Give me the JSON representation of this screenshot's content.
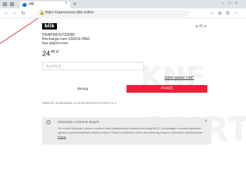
{
  "browser": {
    "tab_title": "blik",
    "url": "https://openscene.blik.online"
  },
  "header": {
    "logo": "blik",
    "lang": "PL"
  },
  "merchant": {
    "line1": "PDAFNK/G725086",
    "line2": "Recharge.com 1566117860",
    "line3": "live.adyen.com"
  },
  "payment": {
    "amount_main": "24",
    "amount_decimal": ",49 zł",
    "code_placeholder": "Kod BLIK",
    "where_link": "Gdzie wpisać kod?",
    "cancel_label": "Anuluj",
    "pay_label": "PŁACĘ",
    "provider_note": "Płatność obsługiwana za pośrednictwem PayPro S.A."
  },
  "alert": {
    "title": "Informacje o ochronie danych",
    "body": "Ten serwis korzysta z plików cookie w celu prawidłowego świadczenia usługi BLIK. Korzystając z serwisu wyrażasz zgodę na przechowywanie plików cookie w Twoim urządzeniu, które nie zawierają danych osobowych użytkowników.",
    "more": "Więcej"
  },
  "watermark": {
    "text1": "CSIRT",
    "text2": "KNF"
  },
  "colors": {
    "pay_button": "#e8203a",
    "logo_bg": "#000000"
  }
}
